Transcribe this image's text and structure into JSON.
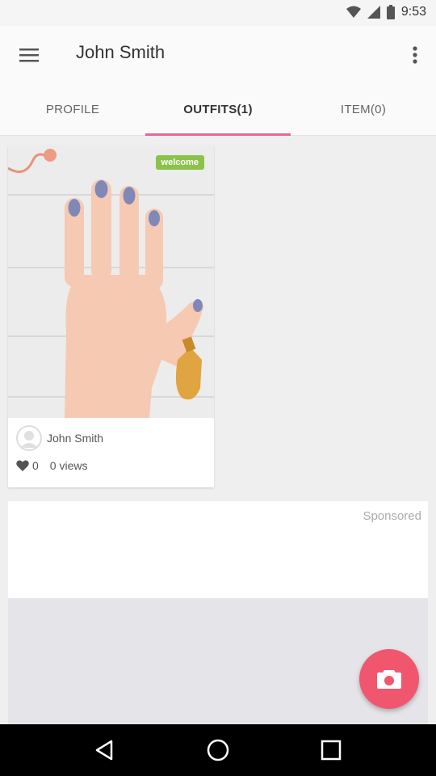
{
  "status_bar": {
    "time": "9:53",
    "icons": [
      "wifi-icon",
      "signal-icon",
      "battery-icon"
    ]
  },
  "app_bar": {
    "title": "John Smith",
    "menu_icon": "hamburger-menu-icon",
    "more_icon": "more-vert-icon"
  },
  "tabs": [
    {
      "label": "PROFILE",
      "active": false
    },
    {
      "label": "OUTFITS(1)",
      "active": true
    },
    {
      "label": "ITEM(0)",
      "active": false
    }
  ],
  "outfit": {
    "badge": "welcome",
    "owner_name": "John Smith",
    "likes": "0",
    "views": "0 views"
  },
  "sponsored": {
    "label": "Sponsored"
  },
  "fab": {
    "icon": "camera-icon"
  },
  "colors": {
    "accent": "#f06292",
    "fab": "#f0576e",
    "badge": "#8bc34a"
  },
  "nav_bar": {
    "icons": [
      "back-icon",
      "home-icon",
      "recents-icon"
    ]
  }
}
